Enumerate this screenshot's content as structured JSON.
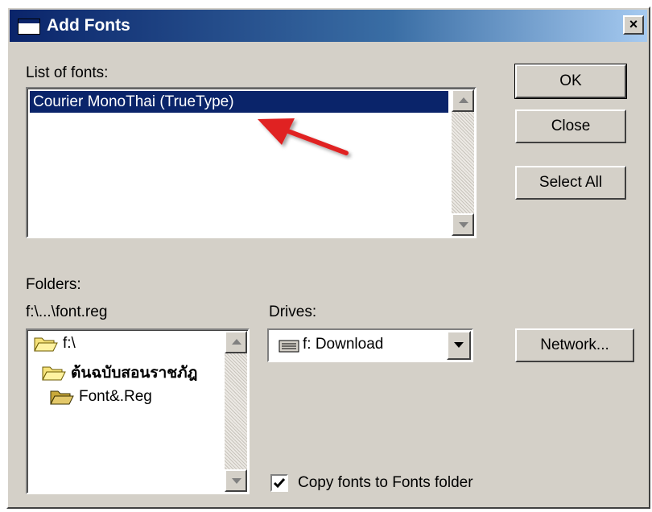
{
  "window": {
    "title": "Add Fonts",
    "close_glyph": "×"
  },
  "fonts_list": {
    "label": "List of fonts:",
    "items": [
      "Courier MonoThai (TrueType)"
    ]
  },
  "buttons": {
    "ok": "OK",
    "close": "Close",
    "select_all": "Select All",
    "network": "Network..."
  },
  "folders": {
    "label": "Folders:",
    "path": "f:\\...\\font.reg",
    "items": [
      {
        "name": "f:\\",
        "icon": "open-folder-icon"
      },
      {
        "name": "ต้นฉบับสอนราชภัฎ",
        "icon": "open-folder-icon"
      },
      {
        "name": "Font&.Reg",
        "icon": "open-folder-icon"
      }
    ]
  },
  "drives": {
    "label": "Drives:",
    "selected": "f: Download",
    "icon": "drive-icon"
  },
  "copy_option": {
    "label": "Copy fonts to Fonts folder",
    "checked": true
  },
  "colors": {
    "selection": "#0a246a",
    "face": "#d4d0c8",
    "annotation_arrow": "#e02020"
  }
}
